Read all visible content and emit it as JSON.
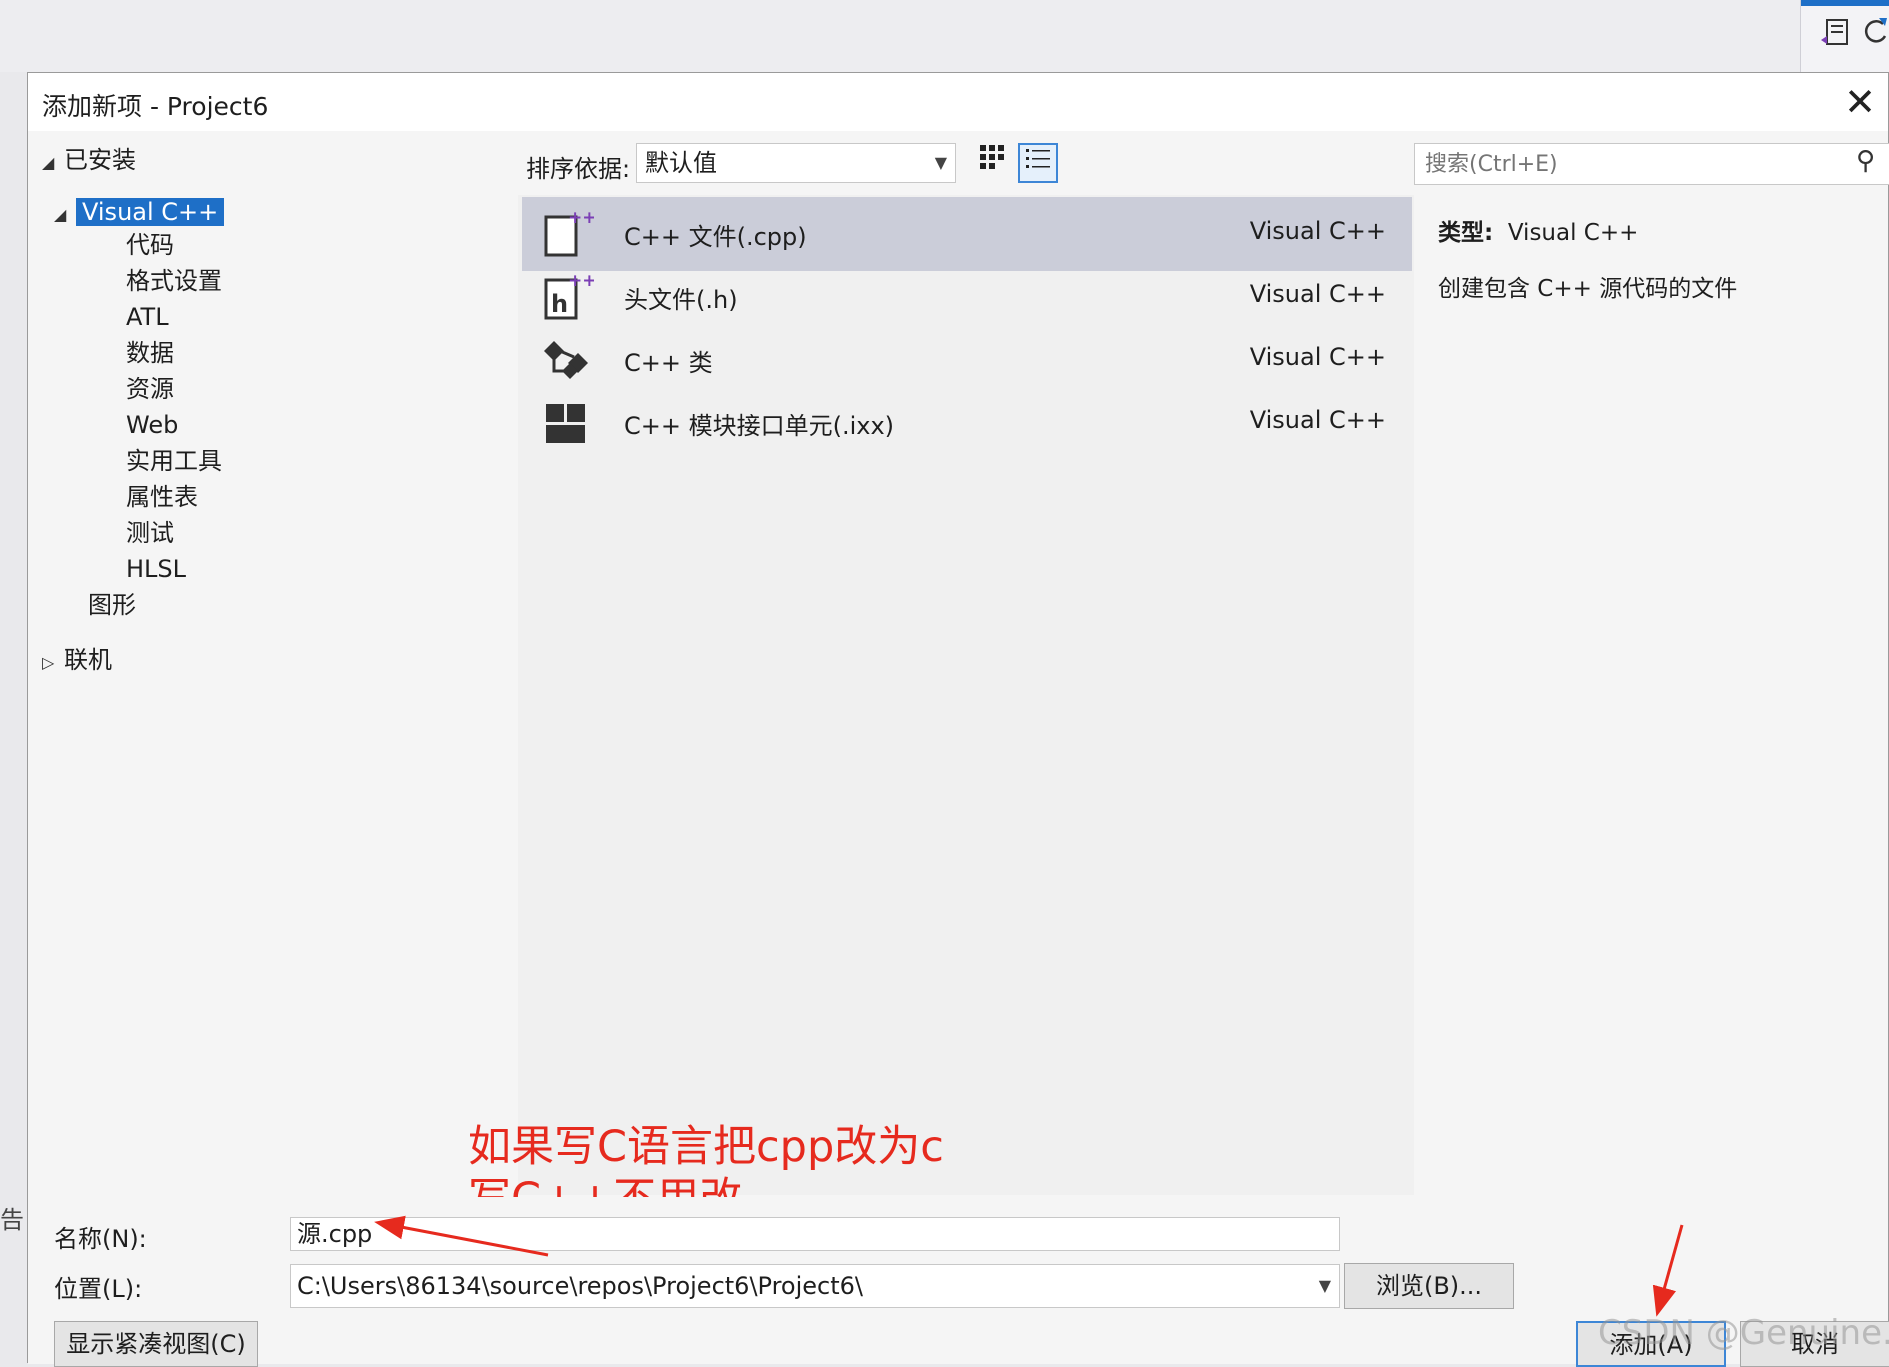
{
  "dialog": {
    "title": "添加新项 - Project6",
    "close_glyph": "✕"
  },
  "tree": {
    "installed": "已安装",
    "visual_cpp": "Visual C++",
    "children": [
      "代码",
      "格式设置",
      "ATL",
      "数据",
      "资源",
      "Web",
      "实用工具",
      "属性表",
      "测试",
      "HLSL"
    ],
    "graphics": "图形",
    "online": "联机"
  },
  "toolbar": {
    "sort_label": "排序依据:",
    "sort_value": "默认值",
    "search_placeholder": "搜索(Ctrl+E)"
  },
  "templates": [
    {
      "name": "C++ 文件(.cpp)",
      "type": "Visual C++",
      "icon": "cpp-file-icon",
      "selected": true
    },
    {
      "name": "头文件(.h)",
      "type": "Visual C++",
      "icon": "header-file-icon",
      "selected": false
    },
    {
      "name": "C++ 类",
      "type": "Visual C++",
      "icon": "class-icon",
      "selected": false
    },
    {
      "name": "C++ 模块接口单元(.ixx)",
      "type": "Visual C++",
      "icon": "module-icon",
      "selected": false
    }
  ],
  "details": {
    "type_label": "类型:",
    "type_value": "Visual C++",
    "description": "创建包含 C++ 源代码的文件"
  },
  "annotation": {
    "line1": "如果写C语言把cpp改为c",
    "line2": "写C++不用改",
    "color": "#e62a1e"
  },
  "form": {
    "name_label": "名称(N):",
    "name_value": "源.cpp",
    "location_label": "位置(L):",
    "location_value": "C:\\Users\\86134\\source\\repos\\Project6\\Project6\\",
    "browse_label": "浏览(B)...",
    "compact_label": "显示紧凑视图(C)",
    "add_label": "添加(A)",
    "cancel_label": "取消"
  },
  "watermark": "CSDN @Genuine...",
  "left_hint": "告",
  "colors": {
    "selection": "#1e6fc7",
    "list_selected": "#cbcdd9",
    "accent_border": "#3d86d6"
  }
}
